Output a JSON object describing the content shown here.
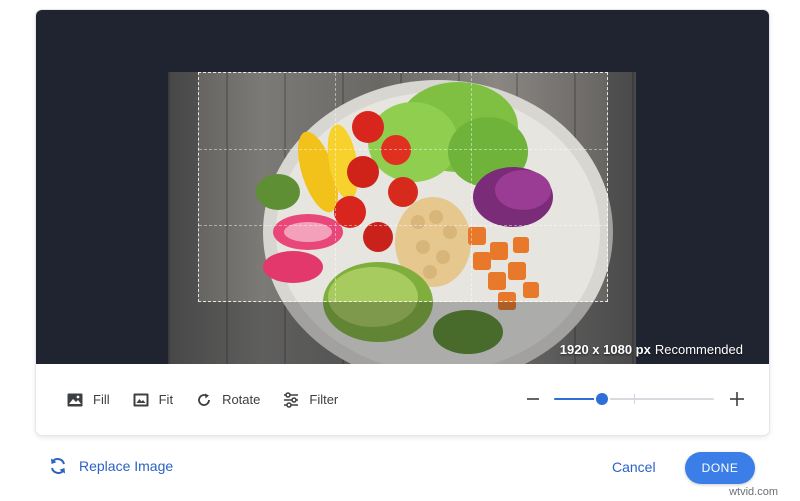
{
  "editor": {
    "resolution_value": "1920 x 1080 px",
    "resolution_note": "Recommended"
  },
  "toolbar": {
    "tools": [
      {
        "label": "Fill",
        "icon": "image-icon"
      },
      {
        "label": "Fit",
        "icon": "image-frame-icon"
      },
      {
        "label": "Rotate",
        "icon": "rotate-icon"
      },
      {
        "label": "Filter",
        "icon": "sliders-icon"
      }
    ],
    "zoom": {
      "minus_icon": "minus-icon",
      "plus_icon": "plus-icon",
      "level": 0.3
    }
  },
  "footer": {
    "replace_label": "Replace Image",
    "replace_icon": "refresh-icon",
    "cancel_label": "Cancel",
    "done_label": "DONE"
  },
  "watermark": "wtvid.com",
  "colors": {
    "accent": "#3b7ee8",
    "link": "#2b62c4",
    "stage_bg": "#1f2430"
  }
}
